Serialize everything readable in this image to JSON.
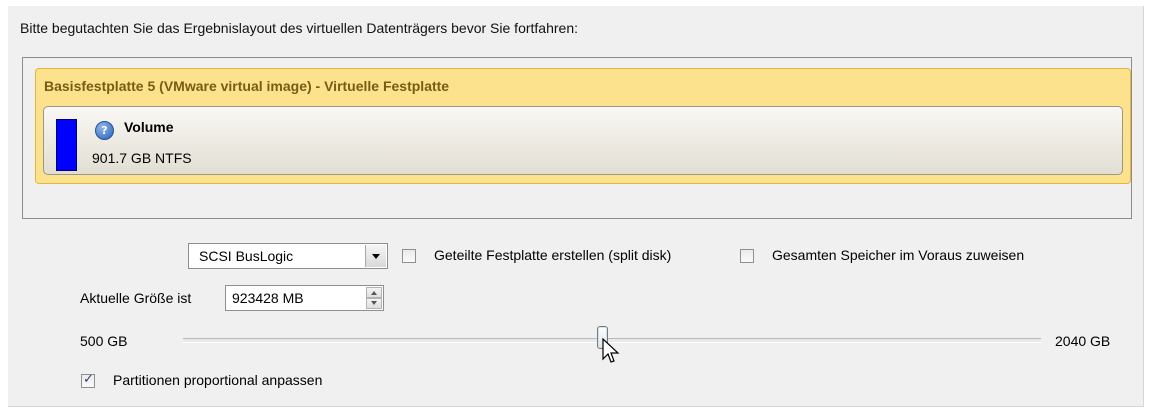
{
  "instruction": "Bitte begutachten Sie das Ergebnislayout des virtuellen Datenträgers bevor Sie fortfahren:",
  "disk": {
    "title": "Basisfestplatte 5 (VMware virtual image) - Virtuelle Festplatte",
    "volume": {
      "name": "Volume",
      "size": "901.7 GB NTFS",
      "color": "#0000ff",
      "icon": "info-icon"
    },
    "header_color": "#fce28d"
  },
  "controller": {
    "selected": "SCSI BusLogic"
  },
  "options": {
    "split_disk_label": "Geteilte Festplatte erstellen (split disk)",
    "split_disk_checked": false,
    "preallocate_label": "Gesamten Speicher im Voraus zuweisen",
    "preallocate_checked": false,
    "proportional_label": "Partitionen proportional anpassen",
    "proportional_checked": true
  },
  "size": {
    "label": "Aktuelle Größe ist",
    "value": "923428 MB"
  },
  "slider": {
    "min_label": "500 GB",
    "max_label": "2040 GB",
    "level_fraction": 0.48
  }
}
